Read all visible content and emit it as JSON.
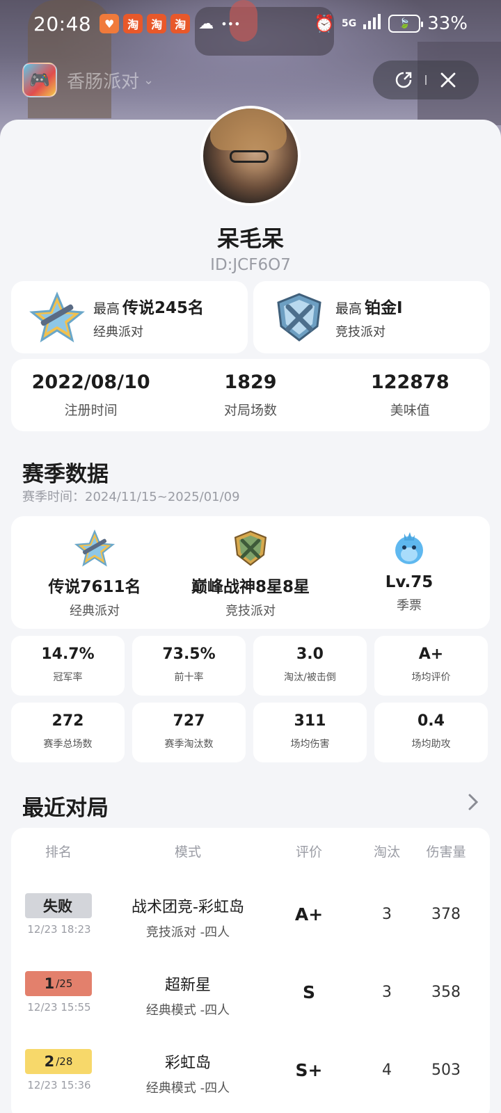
{
  "status_bar": {
    "time": "20:48",
    "notif_taobao": "淘",
    "network": "5G",
    "battery_percent": "33%"
  },
  "app_bar": {
    "app_name": "香肠派对",
    "chevron": "⌄"
  },
  "profile": {
    "username": "呆毛呆",
    "user_id": "ID:JCF6O7"
  },
  "rank_cards": [
    {
      "prefix": "最高",
      "rank": "传说245名",
      "mode": "经典派对",
      "emblem": "legend-star"
    },
    {
      "prefix": "最高",
      "rank": "铂金I",
      "mode": "竞技派对",
      "emblem": "platinum-shield"
    }
  ],
  "overview": [
    {
      "value": "2022/08/10",
      "label": "注册时间"
    },
    {
      "value": "1829",
      "label": "对局场数"
    },
    {
      "value": "122878",
      "label": "美味值"
    }
  ],
  "season": {
    "title": "赛季数据",
    "time": "赛季时间：2024/11/15~2025/01/09",
    "highlights": [
      {
        "value": "传说7611名",
        "label": "经典派对",
        "emblem": "legend-star"
      },
      {
        "value": "巅峰战神8星8星",
        "label": "竞技派对",
        "emblem": "peak-warrior"
      },
      {
        "value": "Lv.75",
        "label": "季票",
        "emblem": "blue-bird"
      }
    ],
    "stats": [
      {
        "value": "14.7%",
        "label": "冠军率"
      },
      {
        "value": "73.5%",
        "label": "前十率"
      },
      {
        "value": "3.0",
        "label": "淘汰/被击倒"
      },
      {
        "value": "A+",
        "label": "场均评价"
      },
      {
        "value": "272",
        "label": "赛季总场数"
      },
      {
        "value": "727",
        "label": "赛季淘汰数"
      },
      {
        "value": "311",
        "label": "场均伤害"
      },
      {
        "value": "0.4",
        "label": "场均助攻"
      }
    ]
  },
  "recent": {
    "title": "最近对局",
    "headers": [
      "排名",
      "模式",
      "评价",
      "淘汰",
      "伤害量"
    ],
    "rows": [
      {
        "rank": "失败",
        "rank_total": "",
        "time": "12/23 18:23",
        "mode": "战术团竞-彩虹岛",
        "sub": "竞技派对 -四人",
        "grade": "A+",
        "elims": "3",
        "damage": "378",
        "badge_color": "#d3d5da"
      },
      {
        "rank": "1",
        "rank_total": "/25",
        "time": "12/23 15:55",
        "mode": "超新星",
        "sub": "经典模式 -四人",
        "grade": "S",
        "elims": "3",
        "damage": "358",
        "badge_color": "#e3806c"
      },
      {
        "rank": "2",
        "rank_total": "/28",
        "time": "12/23 15:36",
        "mode": "彩虹岛",
        "sub": "经典模式 -四人",
        "grade": "S+",
        "elims": "4",
        "damage": "503",
        "badge_color": "#f7d86a"
      }
    ]
  }
}
